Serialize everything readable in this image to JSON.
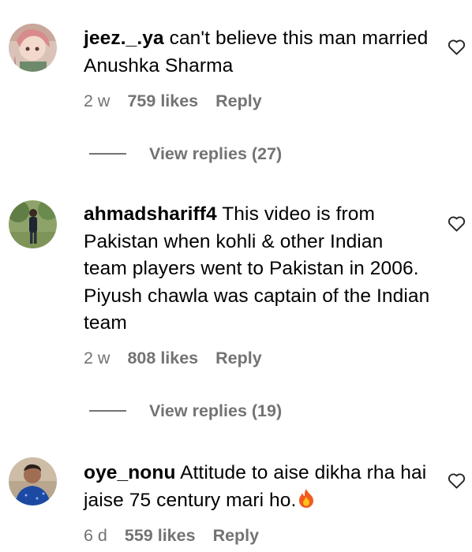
{
  "comments": [
    {
      "username": "jeez._.ya",
      "text": " can't believe this man married Anushka Sharma",
      "time": "2 w",
      "likes": "759 likes",
      "reply": "Reply",
      "view_replies": "View replies (27)",
      "avatar_icon": "avatar-anime-character"
    },
    {
      "username": "ahmadshariff4",
      "text": " This video is from Pakistan when kohli & other Indian team players went to Pakistan in 2006. Piyush chawla was captain of the Indian team",
      "time": "2 w",
      "likes": "808 likes",
      "reply": "Reply",
      "view_replies": "View replies (19)",
      "avatar_icon": "avatar-man-outdoors"
    },
    {
      "username": "oye_nonu",
      "text": " Attitude to aise dikha rha hai jaise 75 century mari ho.",
      "emoji": "🔥",
      "time": "6 d",
      "likes": "559 likes",
      "reply": "Reply",
      "avatar_icon": "avatar-man-blue-shirt"
    }
  ],
  "colors": {
    "text": "#000000",
    "secondary": "#737373",
    "background": "#ffffff"
  },
  "icons": {
    "like": "heart-outline-icon",
    "fire": "fire-emoji-icon"
  }
}
